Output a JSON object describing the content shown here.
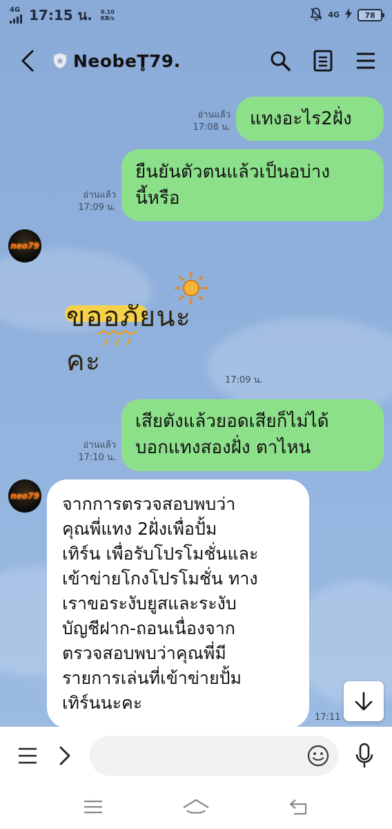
{
  "status_bar": {
    "network_left": "4G",
    "time": "17:15 น.",
    "speed_value": "0.10",
    "speed_unit": "KB/s",
    "network_right": "4G",
    "battery": "78"
  },
  "header": {
    "title": "NeobeT̥79.",
    "icons": [
      "back-icon",
      "shield-icon",
      "search-icon",
      "notes-icon",
      "menu-icon"
    ]
  },
  "messages": [
    {
      "direction": "out",
      "text": "แทงอะไร2ฝั่ง",
      "read_label": "อ่านแล้ว",
      "time": "17:08 น."
    },
    {
      "direction": "out",
      "text_lines": [
        "ยืนยันตัวตนแล้วเป็นอบ่าง",
        "นี้หรือ"
      ],
      "read_label": "อ่านแล้ว",
      "time": "17:09 น."
    },
    {
      "direction": "in",
      "sticker_text": "ขออภัยนะคะ",
      "time": "17:09 น."
    },
    {
      "direction": "out",
      "text_lines": [
        "เสียตังแล้วยอดเสียก็ไม่ได้",
        "บอกแทงสองฝั่ง ตาไหน"
      ],
      "read_label": "อ่านแล้ว",
      "time": "17:10 น."
    },
    {
      "direction": "in",
      "text_lines": [
        "จากการตรวจสอบพบว่า",
        "คุณพี่แทง 2ฝั่งเพื่อปั้ม",
        "เทิร์น เพื่อรับโปรโมชั่นและ",
        "เข้าข่ายโกงโปรโมชั่น ทาง",
        "เราขอระงับยูสและระงับ",
        "บัญชีฝาก-ถอนเนื่องจาก",
        "ตรวจสอบพบว่าคุณพี่มี",
        "รายการเล่นที่เข้าข่ายปั้ม",
        "เทิร์นนะคะ"
      ],
      "time": "17:11 น."
    }
  ],
  "avatar_label": "neo79",
  "input": {
    "placeholder": ""
  },
  "colors": {
    "chat_bg": "#8fb0dc",
    "outgoing_bubble": "#8de08a",
    "incoming_bubble": "#ffffff"
  }
}
